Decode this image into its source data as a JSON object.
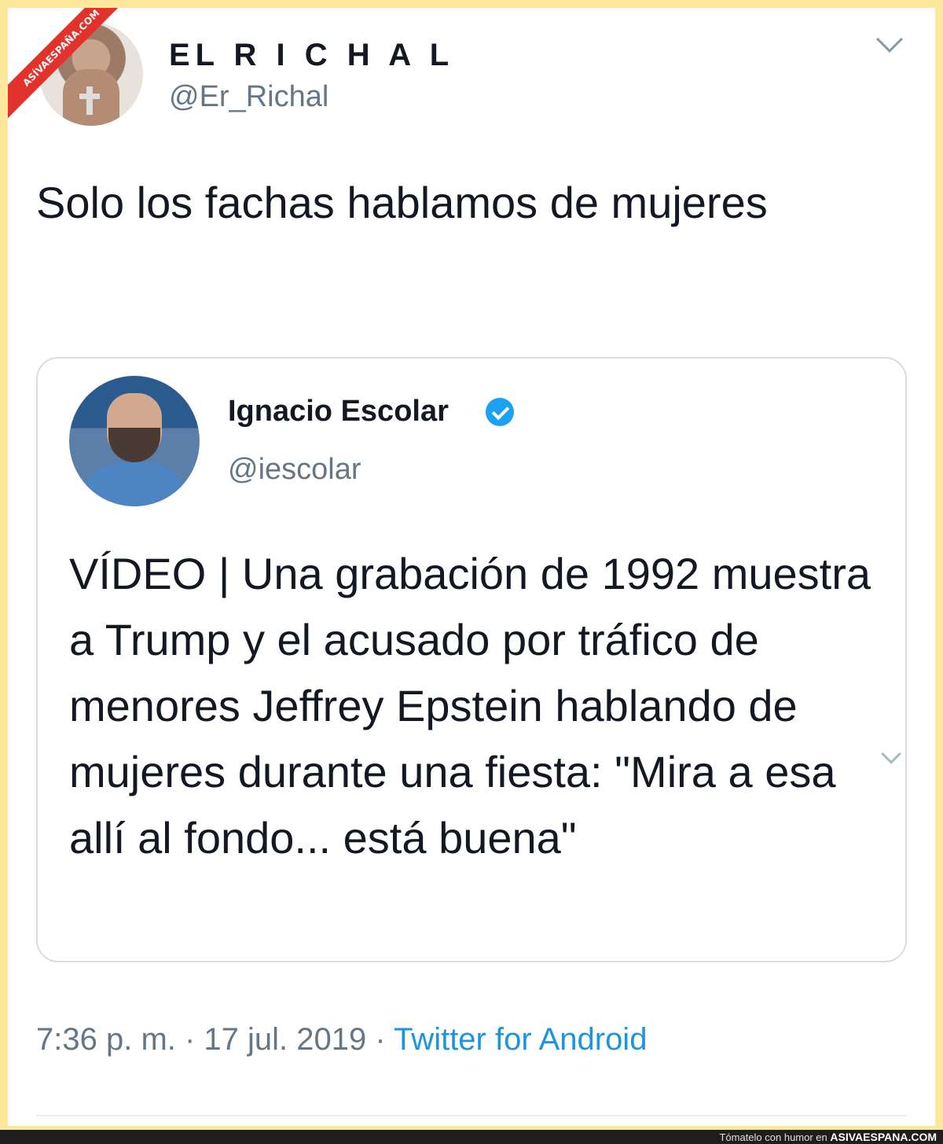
{
  "watermark": {
    "ribbon_text": "ASÍVAESPAÑA.COM",
    "footer_prefix": "Tómatelo con humor en",
    "footer_brand": "ASIVAESPANA.COM"
  },
  "tweet": {
    "author_name": "EL R I C H A L",
    "author_handle": "@Er_Richal",
    "text": "Solo los fachas hablamos de mujeres",
    "timestamp": "7:36 p. m. · 17 jul. 2019 · ",
    "source": "Twitter for Android"
  },
  "quoted_tweet": {
    "author_name": "Ignacio Escolar",
    "author_handle": "@iescolar",
    "text": "VÍDEO | Una grabación de 1992 muestra a Trump y el acusado por tráfico de menores Jeffrey Epstein hablando de mujeres durante una fiesta: \"Mira a esa allí al fondo... está buena\""
  },
  "icons": {
    "main_menu": "chevron-down-icon",
    "quote_menu": "chevron-down-icon",
    "verified": "verified-badge-icon"
  },
  "colors": {
    "border_frame": "#fbe89a",
    "link": "#1b95e0",
    "verified": "#1da1f2",
    "ribbon": "#e3312c"
  }
}
